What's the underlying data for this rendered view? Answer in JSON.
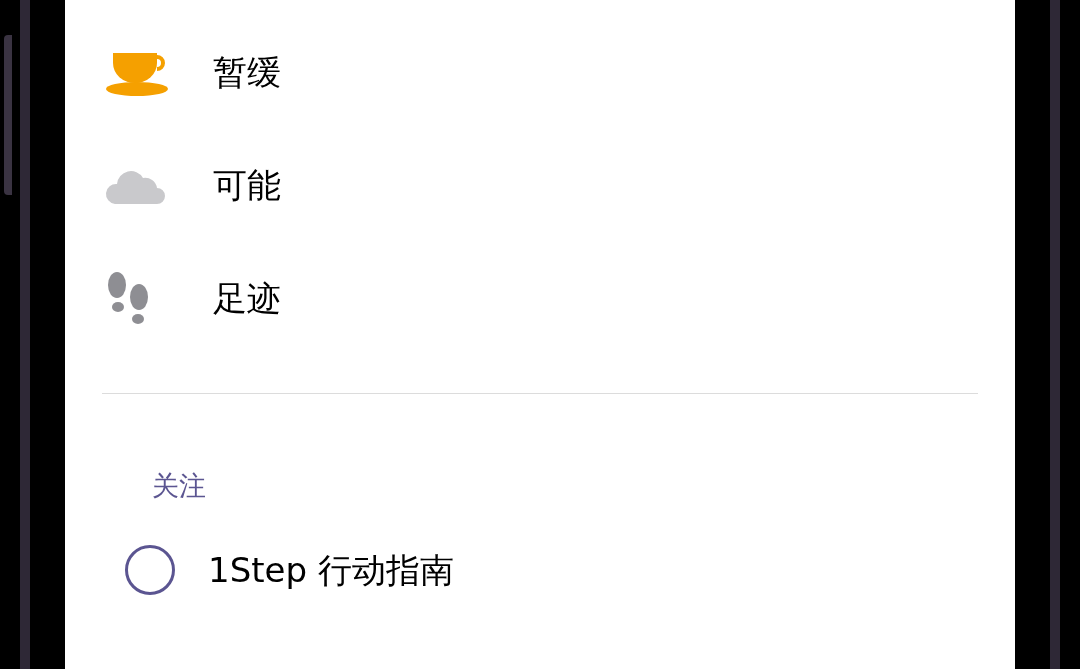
{
  "menu_items": [
    {
      "kind": "cup",
      "label": "暂缓"
    },
    {
      "kind": "cloud",
      "label": "可能"
    },
    {
      "kind": "footprints",
      "label": "足迹"
    }
  ],
  "section": {
    "title": "关注",
    "items": [
      {
        "label": "1Step 行动指南",
        "checked": false
      }
    ]
  }
}
